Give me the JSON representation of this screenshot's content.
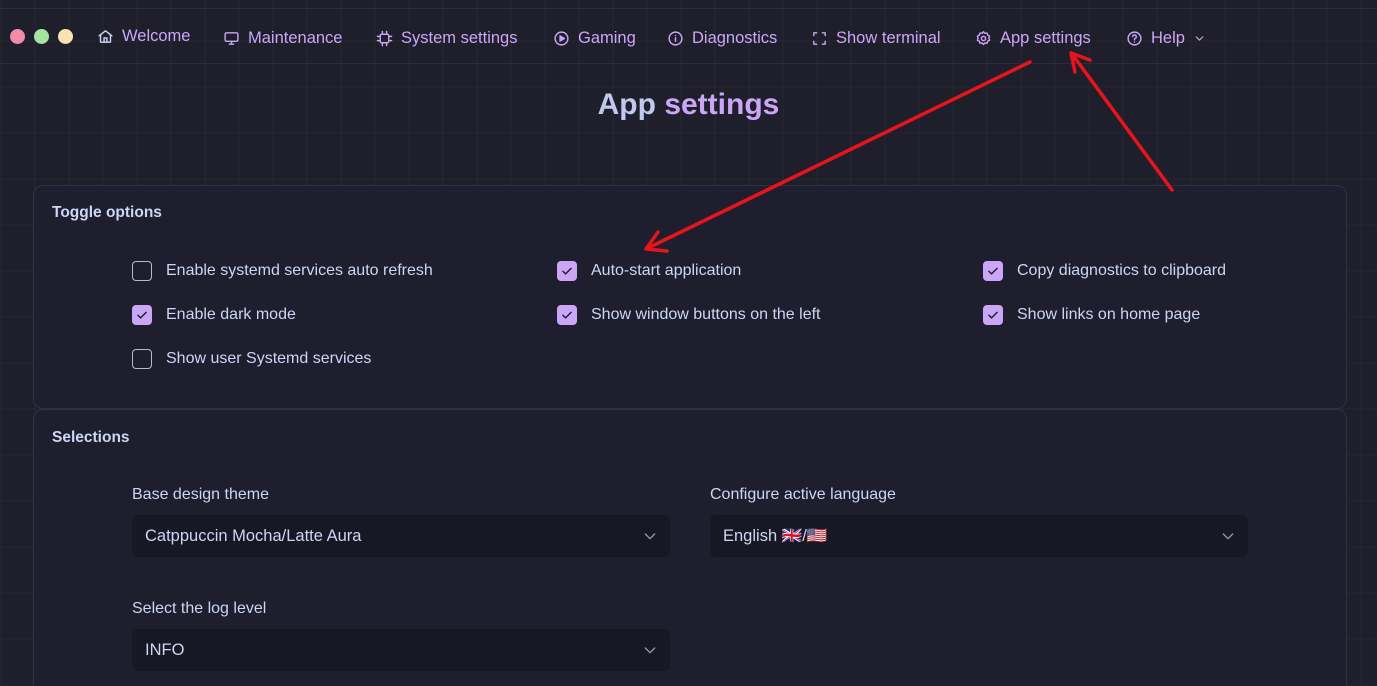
{
  "nav": {
    "items": [
      {
        "label": "Welcome",
        "icon": "home-icon"
      },
      {
        "label": "Maintenance",
        "icon": "monitor-icon"
      },
      {
        "label": "System settings",
        "icon": "chip-icon"
      },
      {
        "label": "Gaming",
        "icon": "play-circle-icon"
      },
      {
        "label": "Diagnostics",
        "icon": "info-circle-icon"
      },
      {
        "label": "Show terminal",
        "icon": "frame-icon"
      },
      {
        "label": "App settings",
        "icon": "gear-icon"
      },
      {
        "label": "Help",
        "icon": "question-circle-icon"
      }
    ]
  },
  "page": {
    "title_part1": "App",
    "title_part2": "settings"
  },
  "toggles": {
    "title": "Toggle options",
    "options": [
      {
        "label": "Enable systemd services auto refresh",
        "checked": false
      },
      {
        "label": "Auto-start application",
        "checked": true
      },
      {
        "label": "Copy diagnostics to clipboard",
        "checked": true
      },
      {
        "label": "Enable dark mode",
        "checked": true
      },
      {
        "label": "Show window buttons on the left",
        "checked": true
      },
      {
        "label": "Show links on home page",
        "checked": true
      },
      {
        "label": "Show user Systemd services",
        "checked": false
      }
    ]
  },
  "selections": {
    "title": "Selections",
    "theme": {
      "label": "Base design theme",
      "value": "Catppuccin Mocha/Latte Aura"
    },
    "language": {
      "label": "Configure active language",
      "value": "English 🇬🇧/🇺🇸"
    },
    "log_level": {
      "label": "Select the log level",
      "value": "INFO"
    }
  },
  "colors": {
    "background": "#1f1f2c",
    "panel": "#1e1e2e",
    "accent": "#cba6f7",
    "text": "#cdd6f4",
    "annotation_arrow": "#e8141c"
  }
}
